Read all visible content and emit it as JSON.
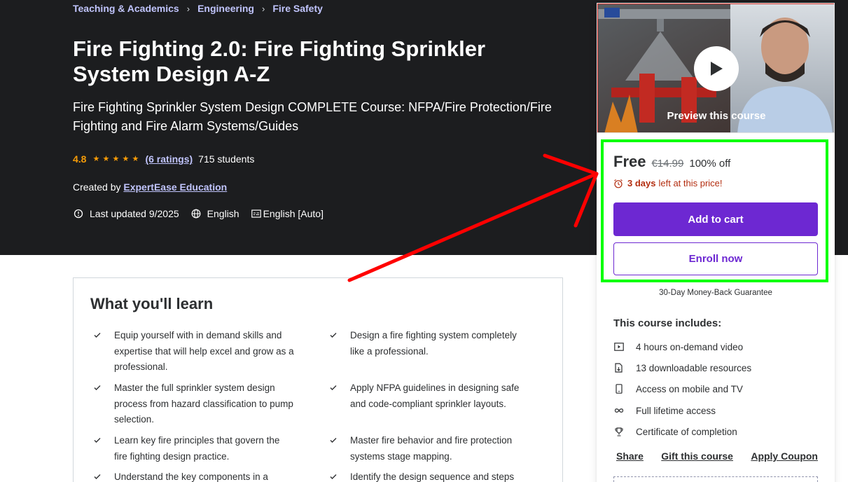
{
  "breadcrumb": {
    "items": [
      "Teaching & Academics",
      "Engineering",
      "Fire Safety"
    ],
    "separator": "›"
  },
  "course": {
    "title": "Fire Fighting 2.0: Fire Fighting Sprinkler System Design A-Z",
    "subtitle": "Fire Fighting Sprinkler System Design COMPLETE Course: NFPA/Fire Protection/Fire Fighting and Fire Alarm Systems/Guides",
    "rating_value": "4.8",
    "stars": 5,
    "ratings_link": "(6 ratings)",
    "students": "715 students",
    "created_by_label": "Created by",
    "instructor": "ExpertEase Education",
    "last_updated": "Last updated 9/2025",
    "language": "English",
    "captions": "English [Auto]"
  },
  "learn": {
    "heading": "What you'll learn",
    "items": [
      "Equip yourself with in demand skills and expertise that will help excel and grow as a professional.",
      "Design a fire fighting system completely like a professional.",
      "Master the full sprinkler system design process from hazard classification to pump selection.",
      "Apply NFPA guidelines in designing safe and code-compliant sprinkler layouts.",
      "Learn key fire principles that govern the fire fighting design practice.",
      "Master fire behavior and fire protection systems stage mapping.",
      "Understand the key components in a sprinkler",
      "Identify the design sequence and steps that"
    ]
  },
  "sidebar": {
    "preview_label": "Preview this course",
    "price_free": "Free",
    "price_original": "€14.99",
    "discount": "100% off",
    "urgency_bold": "3 days",
    "urgency_rest": "left at this price!",
    "add_to_cart": "Add to cart",
    "enroll_now": "Enroll now",
    "guarantee": "30-Day Money-Back Guarantee",
    "includes_title": "This course includes:",
    "includes": [
      {
        "icon": "video-icon",
        "label": "4 hours on-demand video"
      },
      {
        "icon": "download-file-icon",
        "label": "13 downloadable resources"
      },
      {
        "icon": "mobile-icon",
        "label": "Access on mobile and TV"
      },
      {
        "icon": "infinity-icon",
        "label": "Full lifetime access"
      },
      {
        "icon": "trophy-icon",
        "label": "Certificate of completion"
      }
    ],
    "links": [
      "Share",
      "Gift this course",
      "Apply Coupon"
    ]
  },
  "colors": {
    "hero_bg": "#1c1d1f",
    "accent_purple": "#6d28d2",
    "link_lavender": "#c0c4fc",
    "rating_orange": "#f69c08",
    "urgency_red": "#b32d0f",
    "annotation_green": "#00ff00",
    "annotation_red": "#ff0000"
  }
}
